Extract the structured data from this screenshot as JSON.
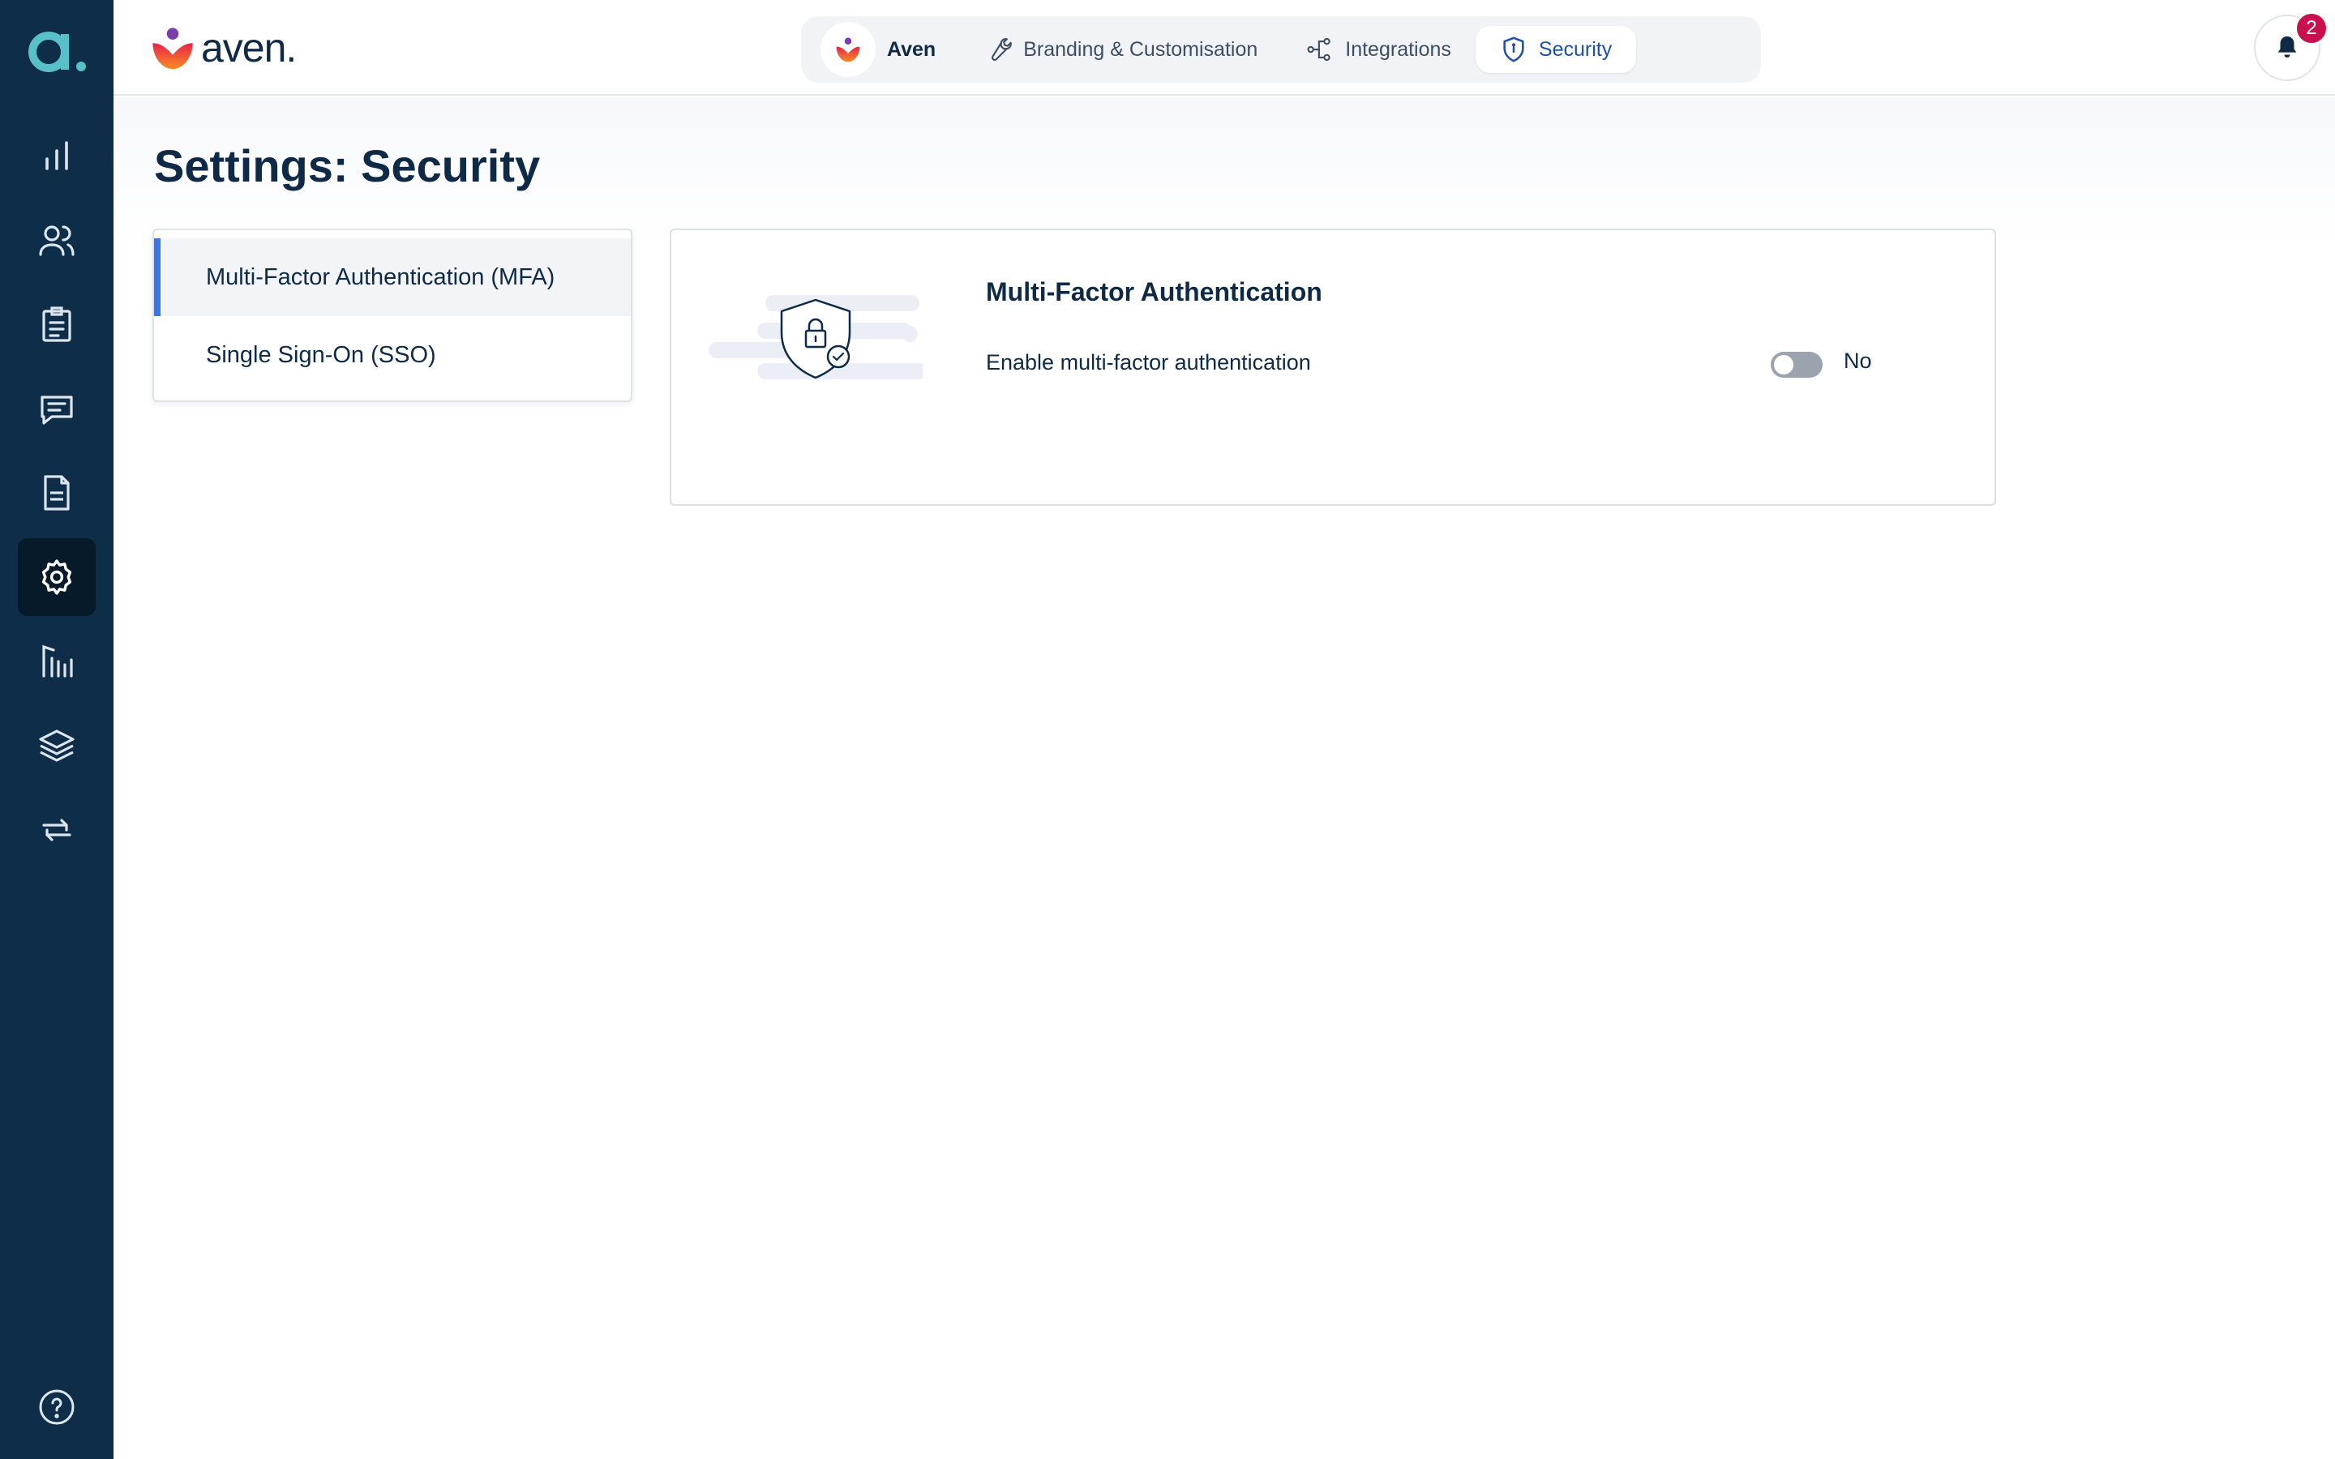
{
  "app": {
    "brand_name": "aven.",
    "rail_logo": "a."
  },
  "rail": {
    "items": [
      {
        "icon": "bar-chart-icon",
        "active": false
      },
      {
        "icon": "users-icon",
        "active": false
      },
      {
        "icon": "clipboard-icon",
        "active": false
      },
      {
        "icon": "chat-icon",
        "active": false
      },
      {
        "icon": "document-icon",
        "active": false
      },
      {
        "icon": "gear-icon",
        "active": true
      },
      {
        "icon": "reports-icon",
        "active": false
      },
      {
        "icon": "layers-icon",
        "active": false
      },
      {
        "icon": "sync-icon",
        "active": false
      }
    ],
    "help_icon": "help-circle-icon"
  },
  "header": {
    "tabs": [
      {
        "label": "Aven",
        "icon": "aven-logo-icon",
        "active": false
      },
      {
        "label": "Branding & Customisation",
        "icon": "wrench-icon",
        "active": false
      },
      {
        "label": "Integrations",
        "icon": "integrations-icon",
        "active": false
      },
      {
        "label": "Security",
        "icon": "shield-icon",
        "active": true
      }
    ],
    "notifications_count": "2"
  },
  "page": {
    "title_strong": "Settings:",
    "title_rest": "Security"
  },
  "subnav": {
    "items": [
      {
        "label": "Multi-Factor Authentication (MFA)",
        "active": true
      },
      {
        "label": "Single Sign-On (SSO)",
        "active": false
      }
    ]
  },
  "mfa": {
    "title": "Multi-Factor Authentication",
    "setting_label": "Enable multi-factor authentication",
    "enabled": false,
    "state_text": "No"
  },
  "colors": {
    "rail_bg": "#0d2d48",
    "accent": "#3d74e0",
    "badge": "#c8104f",
    "active_tab_text": "#1f4fa8"
  }
}
